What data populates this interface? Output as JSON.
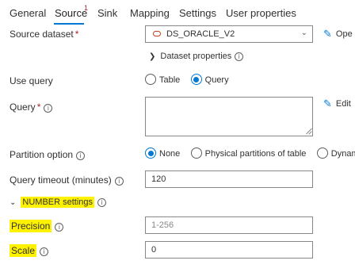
{
  "tabs": [
    {
      "label": "General"
    },
    {
      "label": "Source",
      "badge": "1"
    },
    {
      "label": "Sink"
    },
    {
      "label": "Mapping"
    },
    {
      "label": "Settings"
    },
    {
      "label": "User properties"
    }
  ],
  "active_tab": "Source",
  "source_dataset": {
    "label": "Source dataset",
    "required_mark": "*",
    "value": "DS_ORACLE_V2",
    "open_label": "Ope",
    "dataset_properties_label": "Dataset properties"
  },
  "use_query": {
    "label": "Use query",
    "options": [
      "Table",
      "Query"
    ],
    "selected": "Query"
  },
  "query": {
    "label": "Query",
    "required_mark": "*",
    "value": "",
    "edit_label": "Edit"
  },
  "partition_option": {
    "label": "Partition option",
    "options": [
      "None",
      "Physical partitions of table",
      "Dynam"
    ],
    "selected": "None"
  },
  "query_timeout": {
    "label": "Query timeout (minutes)",
    "value": "120"
  },
  "number_settings": {
    "label": "NUMBER settings",
    "precision_label": "Precision",
    "precision_placeholder": "1-256",
    "scale_label": "Scale",
    "scale_value": "0"
  },
  "colors": {
    "accent": "#0078d4",
    "required": "#a4262c",
    "highlight": "#fff200",
    "dataset_icon": "#c43e1c"
  }
}
